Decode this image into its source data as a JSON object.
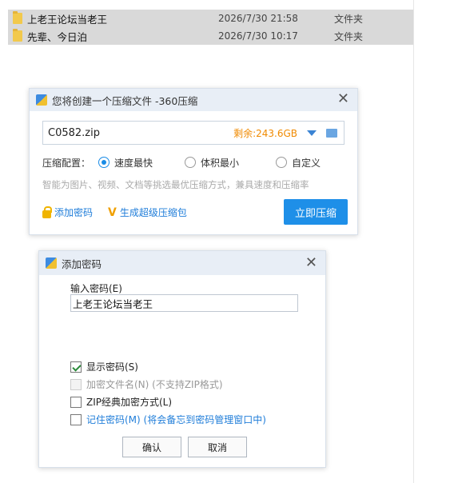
{
  "files": [
    {
      "name": "上老王论坛当老王",
      "date": "2026/7/30 21:58",
      "type": "文件夹"
    },
    {
      "name": "先辈、今日泊",
      "date": "2026/7/30 10:17",
      "type": "文件夹"
    }
  ],
  "compress_dialog": {
    "title": "您将创建一个压缩文件 -360压缩",
    "path": "C0582.zip",
    "free_space": "剩余:243.6GB",
    "config_label": "压缩配置：",
    "options": [
      "速度最快",
      "体积最小",
      "自定义"
    ],
    "selected_option": "速度最快",
    "hint": "智能为图片、视频、文档等挑选最优压缩方式，兼具速度和压缩率",
    "add_password": "添加密码",
    "super_package": "生成超级压缩包",
    "compress_now": "立即压缩"
  },
  "password_dialog": {
    "title": "添加密码",
    "input_label": "输入密码(E)",
    "password_value": "上老王论坛当老王",
    "show_password": "显示密码(S)",
    "encrypt_filename": "加密文件名(N) (不支持ZIP格式)",
    "zip_classic": "ZIP经典加密方式(L)",
    "remember_password": "记住密码(M) (将会备忘到密码管理窗口中)",
    "ok": "确认",
    "cancel": "取消",
    "show_password_checked": true,
    "encrypt_filename_disabled": true
  },
  "colors": {
    "accent": "#1e8fe8",
    "free_space": "#f08a00",
    "selection": "#d9d9d9"
  }
}
